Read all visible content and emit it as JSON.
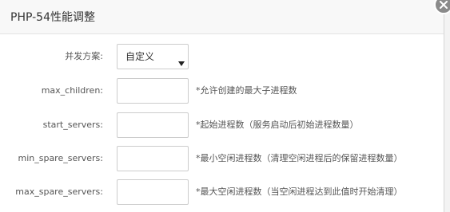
{
  "dialog": {
    "title": "PHP-54性能调整"
  },
  "form": {
    "concurrency": {
      "label": "并发方案:",
      "selected": "自定义"
    },
    "rows": [
      {
        "label": "max_children:",
        "value": "",
        "hint": "*允许创建的最大子进程数"
      },
      {
        "label": "start_servers:",
        "value": "",
        "hint": "*起始进程数（服务启动后初始进程数量）"
      },
      {
        "label": "min_spare_servers:",
        "value": "",
        "hint": "*最小空闲进程数（清理空闲进程后的保留进程数量）"
      },
      {
        "label": "max_spare_servers:",
        "value": "",
        "hint": "*最大空闲进程数（当空闲进程达到此值时开始清理）"
      }
    ]
  },
  "icons": {
    "close": "close-icon",
    "dropdown": "caret-down-icon"
  },
  "colors": {
    "header_bg": "#f8f8f8",
    "close_bg": "#8a8a8a",
    "input_border": "#cccccc"
  }
}
